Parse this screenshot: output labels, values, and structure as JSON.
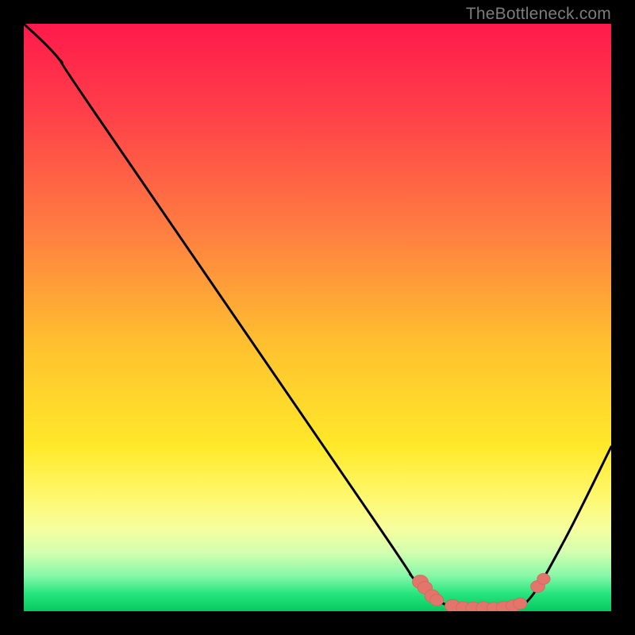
{
  "watermark": "TheBottleneck.com",
  "colors": {
    "frame": "#000000",
    "curve": "#000000",
    "dot_fill": "#e2766d",
    "dot_stroke": "#d8645b"
  },
  "chart_data": {
    "type": "line",
    "title": "",
    "xlabel": "",
    "ylabel": "",
    "xlim": [
      0,
      100
    ],
    "ylim": [
      0,
      100
    ],
    "gradient_stops": [
      {
        "offset": 0,
        "color": "#ff1a4b"
      },
      {
        "offset": 15,
        "color": "#ff3f49"
      },
      {
        "offset": 35,
        "color": "#ff7d41"
      },
      {
        "offset": 55,
        "color": "#ffc22f"
      },
      {
        "offset": 72,
        "color": "#ffe92a"
      },
      {
        "offset": 80,
        "color": "#fff76a"
      },
      {
        "offset": 86,
        "color": "#f6ff9e"
      },
      {
        "offset": 90,
        "color": "#d3ffb0"
      },
      {
        "offset": 94,
        "color": "#86f7a8"
      },
      {
        "offset": 97,
        "color": "#27e57e"
      },
      {
        "offset": 100,
        "color": "#06c95f"
      }
    ],
    "series": [
      {
        "name": "bottleneck-curve",
        "points": [
          {
            "x": 0,
            "y": 100
          },
          {
            "x": 6,
            "y": 94
          },
          {
            "x": 12,
            "y": 85
          },
          {
            "x": 60,
            "y": 15
          },
          {
            "x": 66,
            "y": 6
          },
          {
            "x": 70,
            "y": 2
          },
          {
            "x": 75,
            "y": 0.5
          },
          {
            "x": 82,
            "y": 0.5
          },
          {
            "x": 86,
            "y": 2
          },
          {
            "x": 92,
            "y": 12
          },
          {
            "x": 100,
            "y": 28
          }
        ]
      }
    ],
    "dots": [
      {
        "x": 67.5,
        "y": 5.0,
        "r": 1.35
      },
      {
        "x": 68.3,
        "y": 4.0,
        "r": 1.25
      },
      {
        "x": 69.5,
        "y": 2.6,
        "r": 1.25
      },
      {
        "x": 70.3,
        "y": 1.9,
        "r": 1.15
      },
      {
        "x": 73.0,
        "y": 0.9,
        "r": 1.3
      },
      {
        "x": 74.8,
        "y": 0.6,
        "r": 1.2
      },
      {
        "x": 76.5,
        "y": 0.5,
        "r": 1.25
      },
      {
        "x": 78.3,
        "y": 0.5,
        "r": 1.3
      },
      {
        "x": 80.0,
        "y": 0.5,
        "r": 1.2
      },
      {
        "x": 81.7,
        "y": 0.6,
        "r": 1.25
      },
      {
        "x": 83.3,
        "y": 0.9,
        "r": 1.2
      },
      {
        "x": 84.5,
        "y": 1.3,
        "r": 1.15
      },
      {
        "x": 87.5,
        "y": 4.2,
        "r": 1.2
      },
      {
        "x": 88.5,
        "y": 5.5,
        "r": 1.1
      }
    ]
  }
}
